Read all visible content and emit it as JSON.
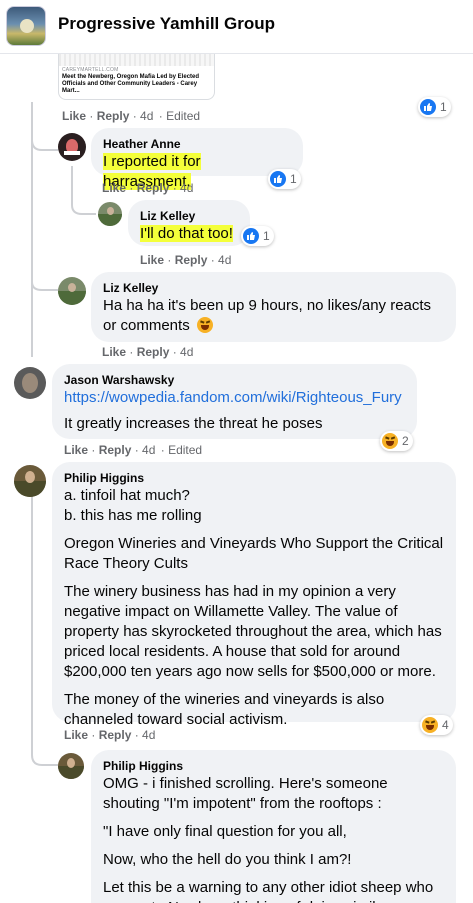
{
  "header": {
    "title": "Progressive Yamhill Group"
  },
  "link_preview": {
    "domain": "CAREYMARTELL.COM",
    "title": "Meet the Newberg, Oregon Mafia Led by Elected Officials and Other Community Leaders - Carey Mart..."
  },
  "comments": [
    {
      "id": "c0",
      "actions": {
        "like": "Like",
        "reply": "Reply",
        "time": "4d",
        "edited": "Edited"
      },
      "reactions": {
        "type": "like",
        "count": "1"
      }
    },
    {
      "id": "c1",
      "author": "Heather Anne",
      "text": "I reported it for harrassment.",
      "actions": {
        "like": "Like",
        "reply": "Reply",
        "time": "4d"
      },
      "reactions": {
        "type": "like",
        "count": "1"
      }
    },
    {
      "id": "c2",
      "author": "Liz Kelley",
      "text": "I'll do that too!",
      "actions": {
        "like": "Like",
        "reply": "Reply",
        "time": "4d"
      },
      "reactions": {
        "type": "like",
        "count": "1"
      }
    },
    {
      "id": "c3",
      "author": "Liz Kelley",
      "text": "Ha ha ha it's been up 9 hours, no likes/any reacts or comments",
      "actions": {
        "like": "Like",
        "reply": "Reply",
        "time": "4d"
      }
    },
    {
      "id": "c4",
      "author": "Jason Warshawsky",
      "link": "https://wowpedia.fandom.com/wiki/Righteous_Fury",
      "text": "It greatly increases the threat he poses",
      "actions": {
        "like": "Like",
        "reply": "Reply",
        "time": "4d",
        "edited": "Edited"
      },
      "reactions": {
        "type": "haha",
        "count": "2"
      }
    },
    {
      "id": "c5",
      "author": "Philip Higgins",
      "paragraphs": [
        "a. tinfoil hat much?",
        "b. this has me rolling",
        "Oregon Wineries and Vineyards Who Support the Critical Race Theory Cults",
        "The winery business has had in my opinion a very negative impact on Willamette Valley. The value of property has skyrocketed throughout the area, which has priced local residents. A house that sold for around $200,000 ten years ago now sells for $500,000 or more.",
        "The money of the wineries and vineyards is also channeled toward social activism."
      ],
      "actions": {
        "like": "Like",
        "reply": "Reply",
        "time": "4d"
      },
      "reactions": {
        "type": "haha",
        "count": "4"
      }
    },
    {
      "id": "c6",
      "author": "Philip Higgins",
      "paragraphs": [
        "OMG - i finished scrolling. Here's someone shouting \"I'm impotent\" from the rooftops :",
        "\"I have only final question for you all,",
        "Now, who the hell do you think I am?!",
        "Let this be a warning to any other idiot sheep who comes to Newberg thinking of doing similar"
      ]
    }
  ],
  "colors": {
    "like_blue": "#1877f2",
    "link": "#216fdb",
    "bubble": "#f0f2f5",
    "highlight": "#f4ff3a",
    "meta": "#65676b"
  }
}
